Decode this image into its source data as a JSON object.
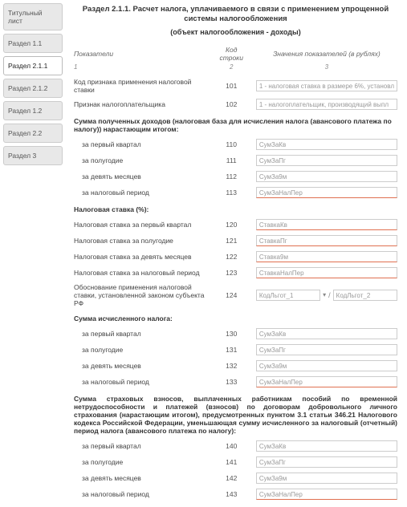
{
  "sidebar": {
    "tabs": [
      "Титульный лист",
      "Раздел 1.1",
      "Раздел 2.1.1",
      "Раздел 2.1.2",
      "Раздел 1.2",
      "Раздел 2.2",
      "Раздел 3"
    ]
  },
  "header": {
    "title": "Раздел 2.1.1. Расчет налога, уплачиваемого в связи с применением упрощенной системы налогообложения",
    "subtitle": "(объект налогообложения - доходы)"
  },
  "cols": {
    "c1": "Показатели",
    "c2": "Код строки",
    "c3": "Значения показателей (в рублях)",
    "n1": "1",
    "n2": "2",
    "n3": "3"
  },
  "r": {
    "r101": {
      "label": "Код признака применения налоговой ставки",
      "val": "1 - налоговая ставка в размере 6%, установл"
    },
    "r102": {
      "label": "Признак налогоплательщика",
      "val": "1 - налогоплательщик, производящий выпл"
    },
    "sec1": "Сумма полученных доходов (налоговая база для исчисления налога (авансового платежа по налогу)) нарастающим итогом:",
    "r110": {
      "label": "за первый квартал",
      "val": "СумЗаКв"
    },
    "r111": {
      "label": "за полугодие",
      "val": "СумЗаПг"
    },
    "r112": {
      "label": "за девять месяцев",
      "val": "СумЗа9м"
    },
    "r113": {
      "label": "за налоговый период",
      "val": "СумЗаНалПер"
    },
    "sec2": "Налоговая ставка (%):",
    "r120": {
      "label": "Налоговая ставка за первый квартал",
      "val": "СтавкаКв"
    },
    "r121": {
      "label": "Налоговая ставка за полугодие",
      "val": "СтавкаПг"
    },
    "r122": {
      "label": "Налоговая ставка за девять месяцев",
      "val": "Ставка9м"
    },
    "r123": {
      "label": "Налоговая ставка за налоговый период",
      "val": "СтавкаНалПер"
    },
    "r124": {
      "label": "Обоснование применения налоговой ставки, установленной законом субъекта РФ",
      "v1": "КодЛьгот_1",
      "v2": "КодЛьгот_2"
    },
    "sec3": "Сумма исчисленного налога:",
    "r130": {
      "label": "за первый квартал",
      "val": "СумЗаКв"
    },
    "r131": {
      "label": "за полугодие",
      "val": "СумЗаПг"
    },
    "r132": {
      "label": "за девять месяцев",
      "val": "СумЗа9м"
    },
    "r133": {
      "label": "за налоговый период",
      "val": "СумЗаНалПер"
    },
    "sec4": "Сумма страховых взносов, выплаченных работникам пособий по временной нетрудоспособности и платежей (взносов) по договорам добровольного личного страхования (нарастающим итогом), предусмотренных пунктом 3.1 статьи 346.21 Налогового кодекса Российской Федерации, уменьшающая сумму исчисленного за налоговый (отчетный) период налога (авансового платежа по налогу):",
    "r140": {
      "label": "за первый квартал",
      "val": "СумЗаКв"
    },
    "r141": {
      "label": "за полугодие",
      "val": "СумЗаПг"
    },
    "r142": {
      "label": "за девять месяцев",
      "val": "СумЗа9м"
    },
    "r143": {
      "label": "за налоговый период",
      "val": "СумЗаНалПер"
    }
  },
  "codes": {
    "r101": "101",
    "r102": "102",
    "r110": "110",
    "r111": "111",
    "r112": "112",
    "r113": "113",
    "r120": "120",
    "r121": "121",
    "r122": "122",
    "r123": "123",
    "r124": "124",
    "r130": "130",
    "r131": "131",
    "r132": "132",
    "r133": "133",
    "r140": "140",
    "r141": "141",
    "r142": "142",
    "r143": "143"
  }
}
